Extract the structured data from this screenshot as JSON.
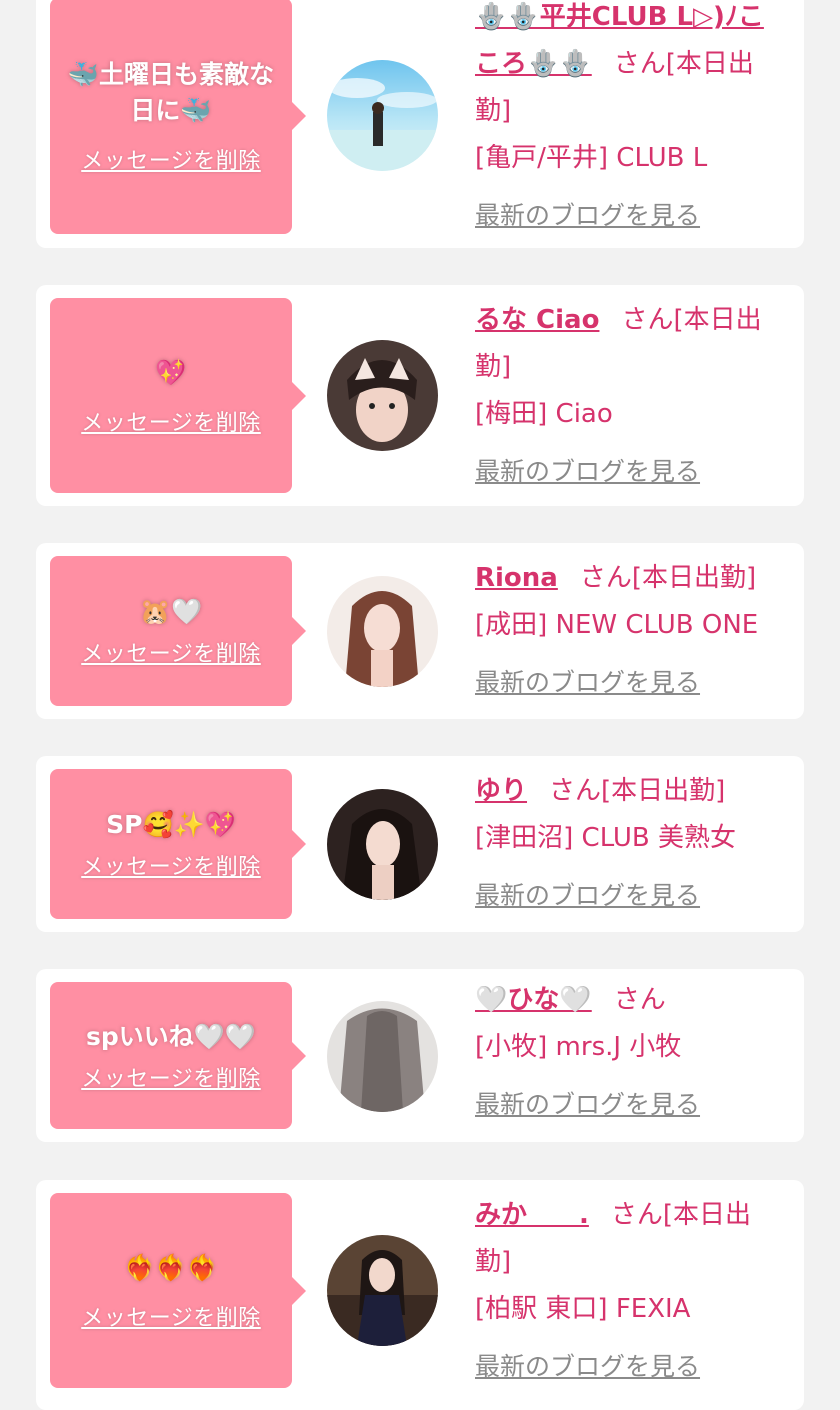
{
  "common": {
    "delete_label": "メッセージを削除",
    "blog_label": "最新のブログを見る"
  },
  "colors": {
    "bubble": "#ff8fa3",
    "accent": "#d6336c",
    "link_gray": "#8a8a8a",
    "background": "#f2f2f2"
  },
  "cards": [
    {
      "message": "🐳土曜日も素敵な日に🐳",
      "name": "🪬🪬平井CLUB L▷)ﾉこころ🪬🪬",
      "san": "さん[本日出勤]",
      "shop": "[亀戸/平井] CLUB L"
    },
    {
      "message": "💖",
      "name": "るな Ciao",
      "san": "さん[本日出勤]",
      "shop": "[梅田] Ciao"
    },
    {
      "message": "🐹🤍",
      "name": "Riona",
      "san": "さん[本日出勤]",
      "shop": "[成田] NEW CLUB ONE"
    },
    {
      "message": "SP🥰✨💖",
      "name": "ゆり",
      "san": "さん[本日出勤]",
      "shop": "[津田沼] CLUB 美熟女"
    },
    {
      "message": "spいいね🤍🤍",
      "name": "🤍ひな🤍",
      "san": "さん",
      "shop": "[小牧] mrs.J 小牧"
    },
    {
      "message": "❤️‍🔥❤️‍🔥❤️‍🔥",
      "name": "みか　　.",
      "san": "さん[本日出勤]",
      "shop": "[柏駅 東口] FEXIA"
    }
  ]
}
